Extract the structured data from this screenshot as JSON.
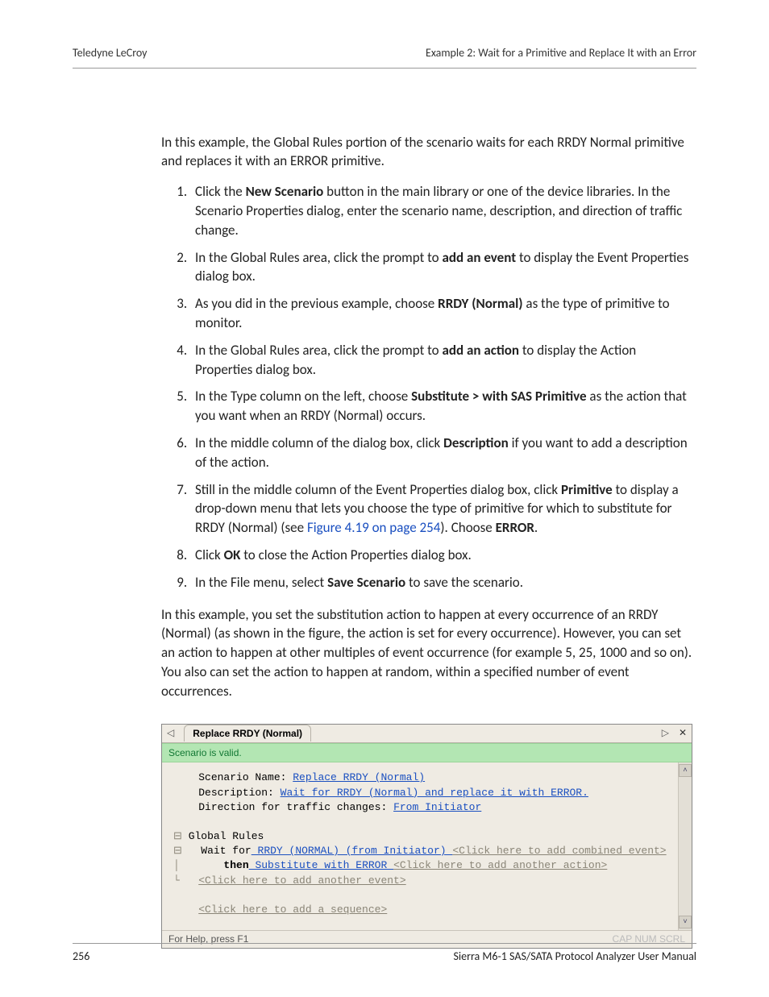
{
  "header": {
    "left": "Teledyne LeCroy",
    "right": "Example 2: Wait for a Primitive and Replace It with an Error"
  },
  "intro": "In this example, the Global Rules portion of the scenario waits for each RRDY Normal primitive and replaces it with an ERROR primitive.",
  "steps": [
    {
      "pre": "Click the ",
      "b": "New Scenario",
      "post": " button in the main library or one of the device libraries. In the Scenario Properties dialog, enter the scenario name, description, and direction of traffic change."
    },
    {
      "pre": "In the Global Rules area, click the prompt to ",
      "b": "add an event",
      "post": " to display the Event Properties dialog box."
    },
    {
      "pre": "As you did in the previous example, choose ",
      "b": "RRDY (Normal)",
      "post": " as the type of primitive to monitor."
    },
    {
      "pre": "In the Global Rules area, click the prompt to ",
      "b": "add an action",
      "post": " to display the Action Properties dialog box."
    },
    {
      "pre": "In the Type column on the left, choose ",
      "b": "Substitute > with SAS Primitive",
      "post": " as the action that you want when an RRDY (Normal) occurs."
    },
    {
      "pre": "In the middle column of the dialog box, click ",
      "b": "Description",
      "post": " if you want to add a description of the action."
    },
    {
      "pre": "Still in the middle column of the Event Properties dialog box, click ",
      "b": "Primitive",
      "post": " to display a drop-down menu that lets you choose the type of primitive for which to substitute for RRDY (Normal) (see ",
      "link": "Figure 4.19 on page 254",
      "post2": "). Choose ",
      "b2": "ERROR",
      "post3": "."
    },
    {
      "pre": "Click ",
      "b": "OK",
      "post": " to close the Action Properties dialog box."
    },
    {
      "pre": "In the File menu, select ",
      "b": "Save Scenario",
      "post": " to save the scenario."
    }
  ],
  "para2": "In this example, you set the substitution action to happen at every occurrence of an RRDY (Normal) (as shown in the figure, the action is set for every occurrence). However, you can set an action to happen at other multiples of event occurrence (for example 5, 25, 1000 and so on). You also can set the action to happen at random, within a specified number of event occurrences.",
  "figure": {
    "tab_title": "Replace RRDY (Normal)",
    "valid_msg": "Scenario is valid.",
    "scenario_name_label": "Scenario Name: ",
    "scenario_name_value": "Replace RRDY (Normal)",
    "description_label": "Description: ",
    "description_value": "Wait for RRDY (Normal) and replace it with ERROR.",
    "direction_label": "Direction for traffic changes: ",
    "direction_value": "From Initiator",
    "global_rules_label": "Global Rules",
    "wait_pre": "Wait for",
    "wait_ev": " RRDY (NORMAL) (from Initiator) ",
    "wait_ghost": "<Click here to add combined event>",
    "then_pre": "then",
    "then_act": " Substitute with ERROR ",
    "then_ghost": "<Click here to add another action>",
    "add_event_ghost": "<Click here to add another event>",
    "add_seq_ghost": "<Click here to add a sequence>",
    "help_text": "For Help, press F1",
    "indicators": "CAP  NUM  SCRL"
  },
  "footer": {
    "page": "256",
    "manual": "Sierra M6-1 SAS/SATA Protocol Analyzer User Manual"
  }
}
